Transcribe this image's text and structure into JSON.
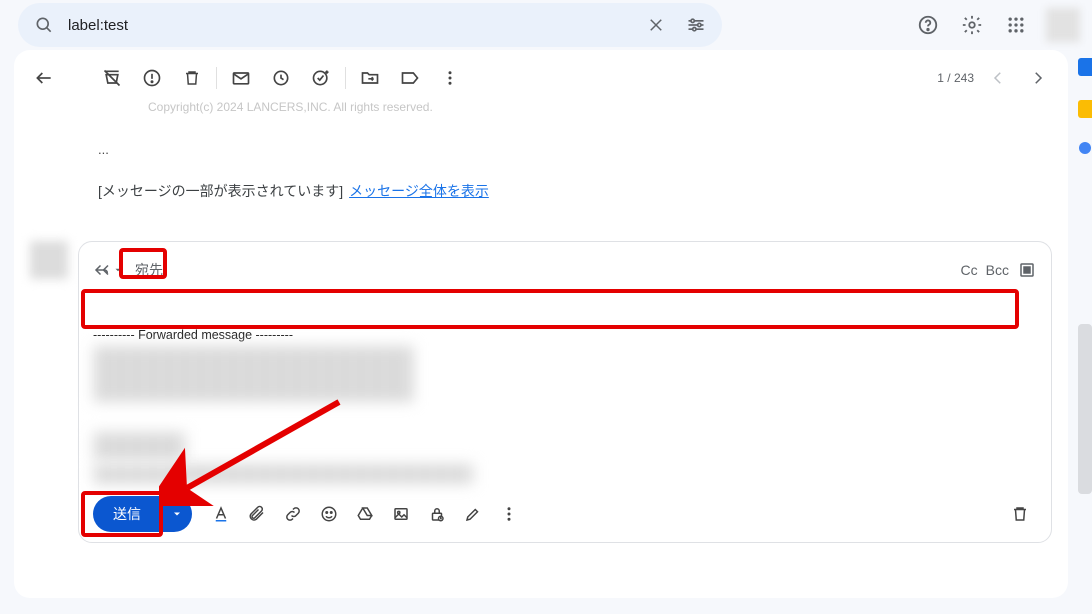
{
  "search": {
    "query": "label:test"
  },
  "toolbar": {
    "page_counter": "1 / 243"
  },
  "mail_preview": {
    "copyright": "Copyright(c) 2024 LANCERS,INC. All rights reserved.",
    "ellipsis": "...",
    "truncated_label": "[メッセージの一部が表示されています]",
    "truncated_link": "メッセージ全体を表示"
  },
  "compose": {
    "recipient_label": "宛先",
    "cc": "Cc",
    "bcc": "Bcc",
    "forward_header": "---------- Forwarded message ---------",
    "send": "送信"
  }
}
